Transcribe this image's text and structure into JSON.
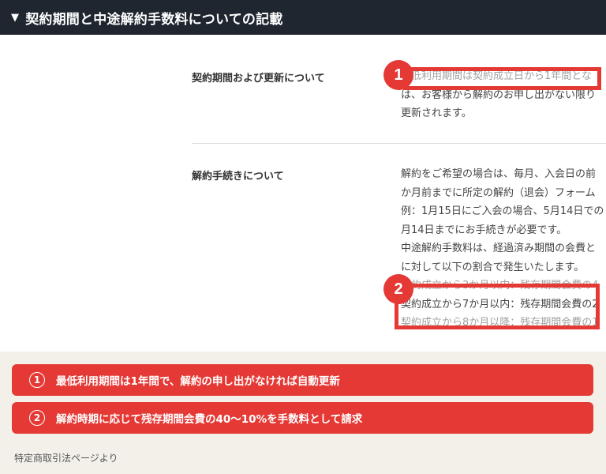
{
  "header": {
    "toggle_icon": "▼",
    "title": "契約期間と中途解約手数料についての記載"
  },
  "rows": [
    {
      "label": "契約期間および更新について",
      "lines": [
        "最低利用期間は契約成立日から1年間とな",
        "は、お客様から解約のお申し出がない限り",
        "更新されます。"
      ]
    },
    {
      "label": "解約手続きについて",
      "lines": [
        "解約をご希望の場合は、毎月、入会日の前",
        "か月前までに所定の解約（退会）フォーム",
        "例：1月15日にご入会の場合、5月14日での",
        "月14日までにお手続きが必要です。",
        "中途解約手数料は、経過済み期間の会費と",
        "に対して以下の割合で発生いたします。",
        "契約成立から3か月以内：残存期間会費の4",
        "契約成立から7か月以内：残存期間会費の2",
        "契約成立から8か月以降：残存期間会費の1"
      ]
    }
  ],
  "callouts": [
    {
      "number": "1"
    },
    {
      "number": "2"
    }
  ],
  "summary": [
    {
      "number": "1",
      "text": "最低利用期間は1年間で、解約の申し出がなければ自動更新"
    },
    {
      "number": "2",
      "text": "解約時期に応じて残存期間会費の40〜10%を手数料として請求"
    }
  ],
  "source": "特定商取引法ページより",
  "colors": {
    "header_bg": "#1f2630",
    "accent_red": "#e53935",
    "page_bg": "#f3f0ea"
  }
}
